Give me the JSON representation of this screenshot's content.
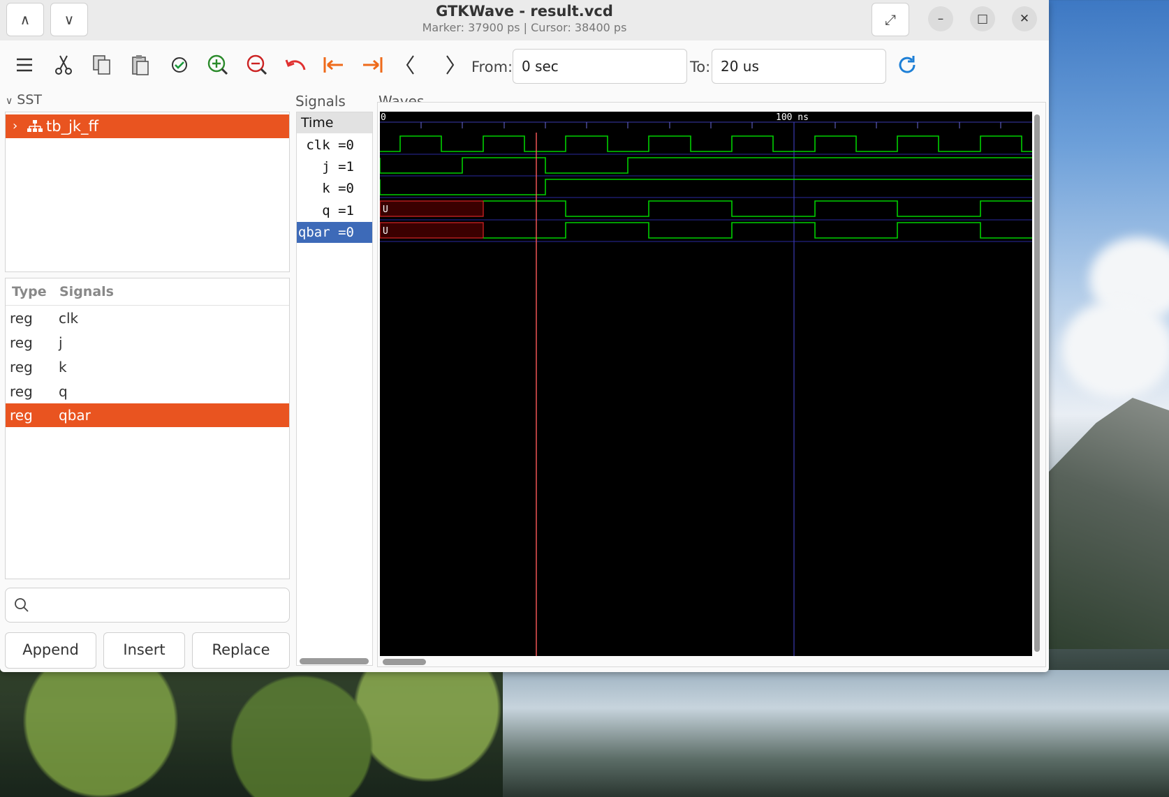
{
  "window": {
    "title": "GTKWave - result.vcd",
    "subtitle": "Marker: 37900 ps  |  Cursor: 38400 ps"
  },
  "toolbar": {
    "from_label": "From:",
    "from_value": "0 sec",
    "to_label": "To:",
    "to_value": "20 us",
    "icons": [
      "menu-icon",
      "cut-icon",
      "copy-icon",
      "paste-icon",
      "select-all-icon",
      "zoom-in-icon",
      "zoom-out-icon",
      "undo-zoom-icon",
      "zoom-to-start-icon",
      "zoom-to-end-icon",
      "previous-edge-icon",
      "next-edge-icon",
      "reload-icon"
    ]
  },
  "sst": {
    "label": "SST",
    "tree_item": "tb_jk_ff"
  },
  "signal_list": {
    "col_type": "Type",
    "col_signals": "Signals",
    "rows": [
      {
        "type": "reg",
        "name": "clk"
      },
      {
        "type": "reg",
        "name": "j"
      },
      {
        "type": "reg",
        "name": "k"
      },
      {
        "type": "reg",
        "name": "q"
      },
      {
        "type": "reg",
        "name": "qbar"
      }
    ],
    "selected": "qbar"
  },
  "search": {
    "placeholder": ""
  },
  "buttons": {
    "append": "Append",
    "insert": "Insert",
    "replace": "Replace"
  },
  "signals_pane": {
    "label": "Signals",
    "time_label": "Time",
    "names": [
      "clk =0",
      "j =1",
      "k =0",
      "q =1",
      "qbar =0"
    ]
  },
  "waves_pane": {
    "label": "Waves",
    "tick_labels": [
      "0",
      "100 ns"
    ],
    "undefined_label": "U"
  },
  "colors": {
    "accent": "#e95420",
    "selection_blue": "#3d6ab8",
    "wave_green": "#00d000",
    "marker_red": "#ff5a5a",
    "undefined_red": "#a01010"
  }
}
